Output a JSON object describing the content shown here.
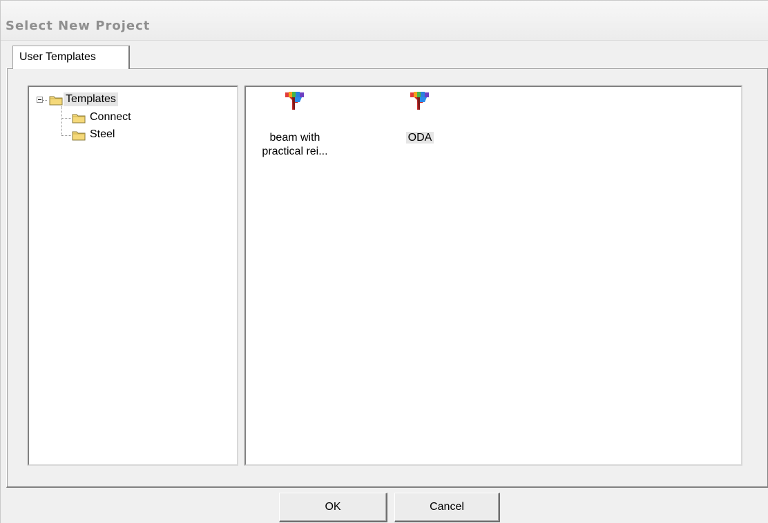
{
  "window": {
    "title": "Select New Project"
  },
  "tabs": [
    {
      "label": "User Templates",
      "active": true
    }
  ],
  "tree": {
    "root": {
      "label": "Templates",
      "icon": "folder-icon",
      "expanded": true,
      "selected": true
    },
    "children": [
      {
        "label": "Connect",
        "icon": "folder-icon"
      },
      {
        "label": "Steel",
        "icon": "folder-icon"
      }
    ]
  },
  "files": [
    {
      "label_line1": "beam with",
      "label_line2": "practical rei...",
      "icon": "template-file-icon",
      "selected": false
    },
    {
      "label_line1": "ODA",
      "label_line2": "",
      "icon": "template-file-icon",
      "selected": true
    }
  ],
  "buttons": {
    "ok": "OK",
    "cancel": "Cancel"
  },
  "colors": {
    "window_bg": "#f0f0f0",
    "pane_bg": "#ffffff",
    "selection": "#e5e5e5",
    "folder": "#f5d97a"
  }
}
